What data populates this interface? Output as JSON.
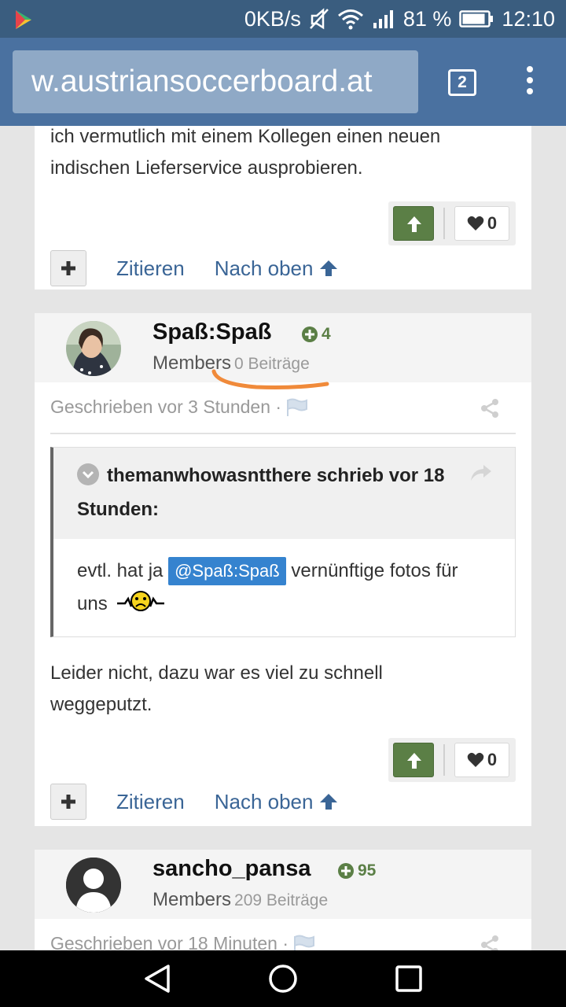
{
  "status_bar": {
    "net_speed": "0KB/s",
    "battery": "81 %",
    "time": "12:10"
  },
  "browser": {
    "url": "w.austriansoccerboard.at",
    "tab_count": "2"
  },
  "post_prev": {
    "text": "ich vermutlich mit einem Kollegen einen neuen indischen Lieferservice ausprobieren.",
    "like_count": "0",
    "quote_label": "Zitieren",
    "top_label": "Nach oben"
  },
  "post_main": {
    "author": "Spaß:Spaß",
    "reputation": "4",
    "group": "Members",
    "posts": "0 Beiträge",
    "meta": "Geschrieben vor 3 Stunden ·",
    "quote": {
      "header": "themanwhowasntthere schrieb vor 18 Stunden:",
      "before": "evtl. hat ja",
      "mention": "@Spaß:Spaß",
      "after": "vernünftige fotos für uns"
    },
    "text": "Leider nicht, dazu war es viel zu schnell weggeputzt.",
    "like_count": "0",
    "quote_label": "Zitieren",
    "top_label": "Nach oben"
  },
  "post_next": {
    "author": "sancho_pansa",
    "reputation": "95",
    "group": "Members",
    "posts": "209 Beiträge",
    "meta": "Geschrieben vor 18 Minuten ·"
  },
  "colors": {
    "browser_bar": "#4a71a0",
    "upvote": "#5b7f46",
    "link": "#3a6596",
    "mention": "#3583cf",
    "annotation": "#f08a3a"
  }
}
